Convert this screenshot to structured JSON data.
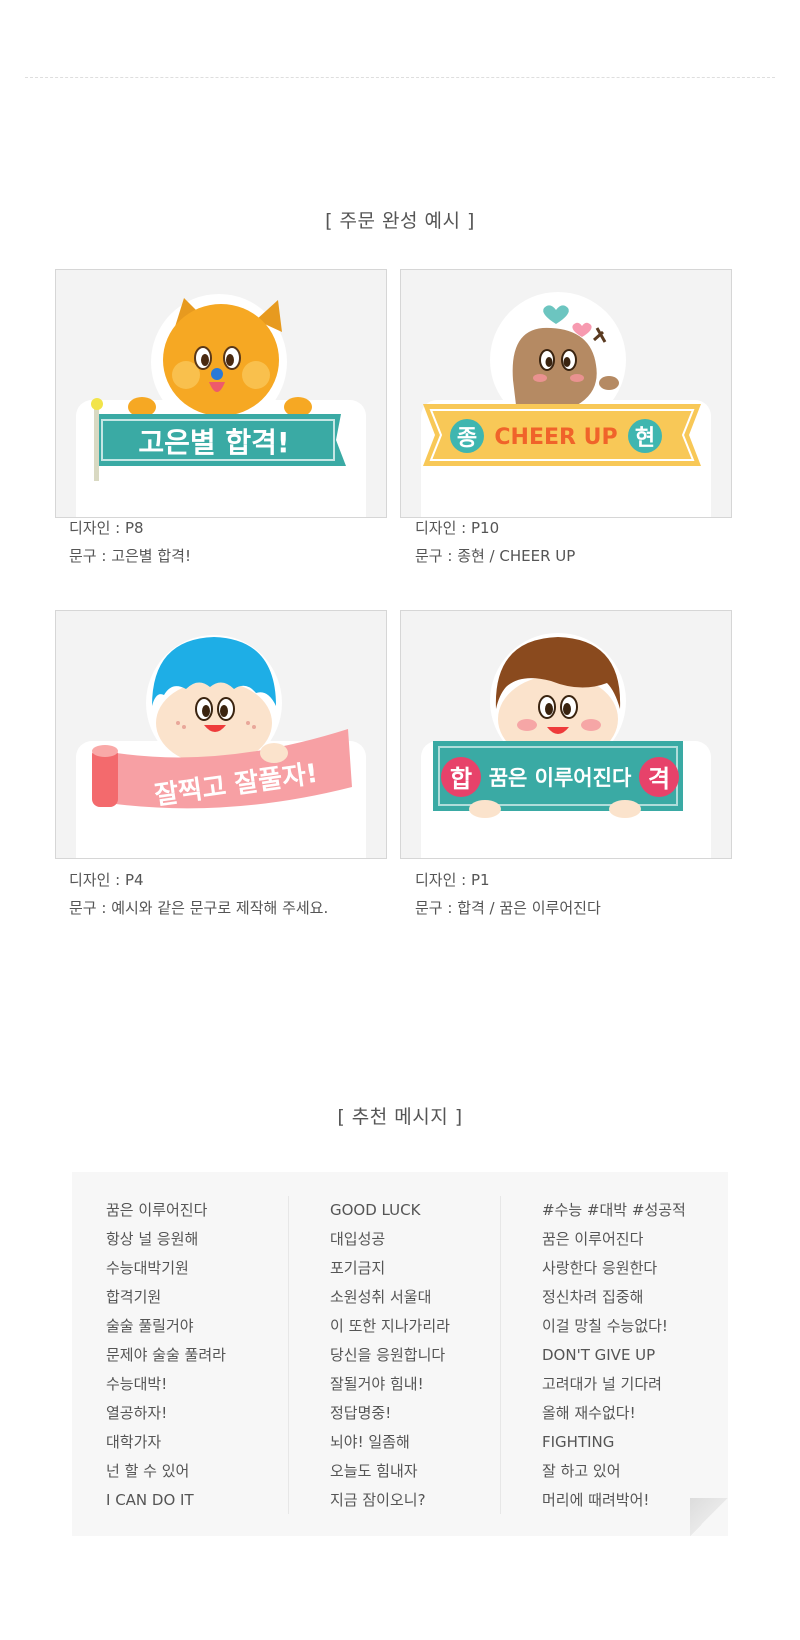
{
  "order_example": {
    "title": "[ 주문 완성 예시 ]",
    "examples": [
      {
        "design": "디자인 : P8",
        "text": "문구 : 고은별 합격!",
        "banner": "고은별 합격!"
      },
      {
        "design": "디자인 : P10",
        "text": "문구 : 종현 / CHEER UP",
        "banner": "CHEER UP",
        "left": "종",
        "right": "현"
      },
      {
        "design": "디자인 : P4",
        "text": "문구 : 예시와 같은 문구로 제작해 주세요.",
        "banner": "잘찍고 잘풀자!"
      },
      {
        "design": "디자인 : P1",
        "text": "문구 : 합격 / 꿈은 이루어진다",
        "banner": "꿈은 이루어진다",
        "left": "합",
        "right": "격"
      }
    ]
  },
  "recommend": {
    "title": "[ 추천 메시지 ]",
    "col1": [
      "꿈은 이루어진다",
      "항상 널 응원해",
      "수능대박기원",
      "합격기원",
      "술술 풀릴거야",
      "문제야 술술 풀려라",
      "수능대박!",
      "열공하자!",
      "대학가자",
      "넌 할 수 있어",
      "I CAN DO IT"
    ],
    "col2": [
      "GOOD LUCK",
      "대입성공",
      "포기금지",
      "소원성취 서울대",
      "이 또한 지나가리라",
      "당신을 응원합니다",
      "잘될거야 힘내!",
      "정답명중!",
      "뇌야! 일좀해",
      "오늘도 힘내자",
      "지금 잠이오니?"
    ],
    "col3": [
      "#수능 #대박 #성공적",
      "꿈은 이루어진다",
      "사랑한다 응원한다",
      "정신차려 집중해",
      "이걸 망칠 수능없다!",
      "DON'T GIVE UP",
      "고려대가 널 기다려",
      "올해 재수없다!",
      "FIGHTING",
      "잘 하고 있어",
      "머리에 때려박어!"
    ]
  }
}
